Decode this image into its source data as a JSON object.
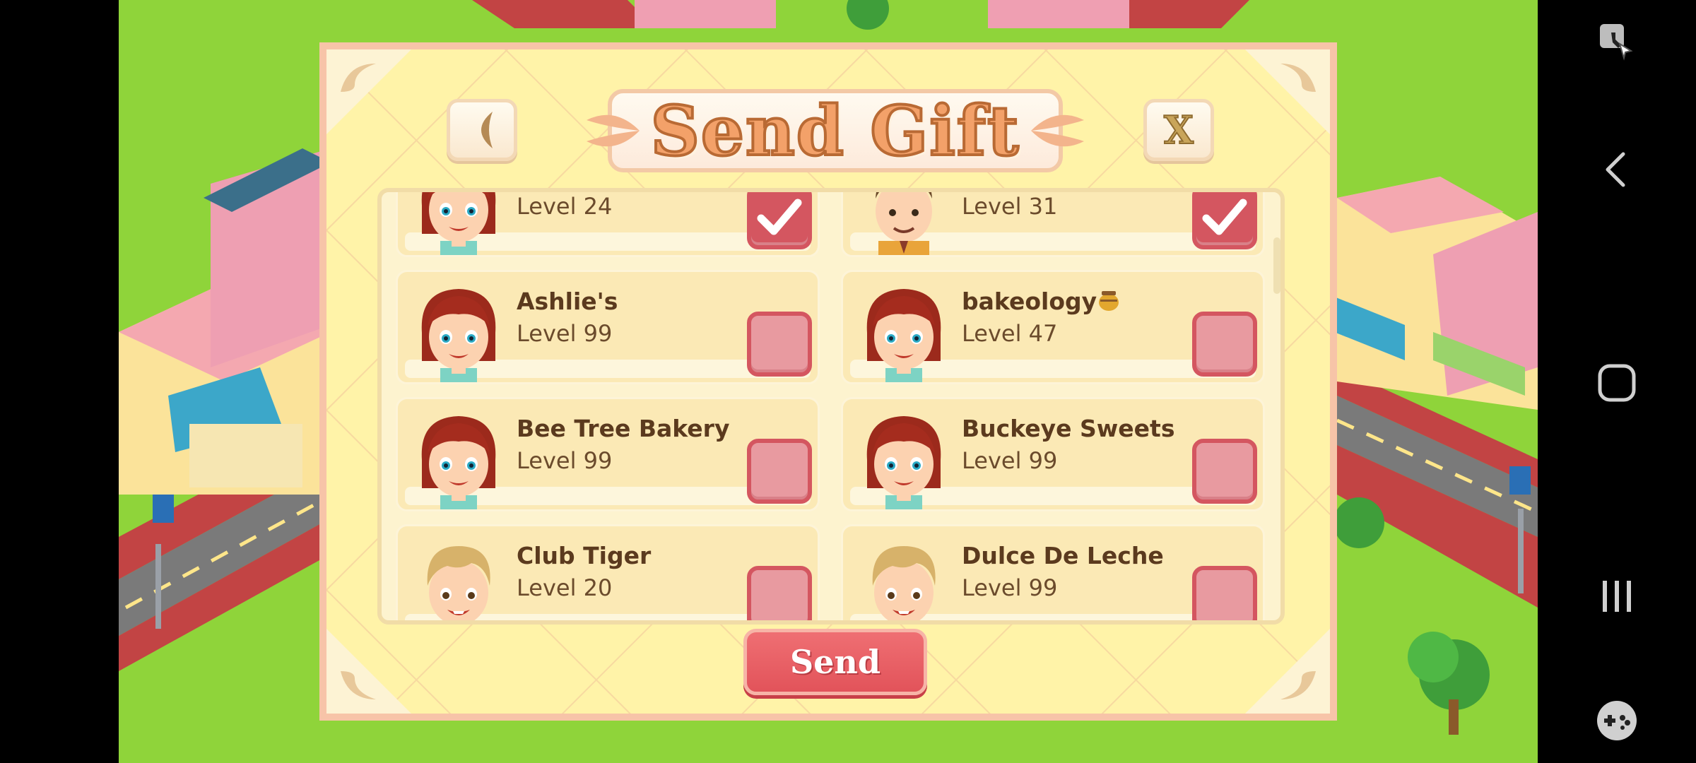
{
  "dialog": {
    "title": "Send Gift",
    "back_icon": "back-arrow-icon",
    "close_label": "X",
    "send_label": "Send"
  },
  "friends": [
    {
      "name": "",
      "level": "Level 24",
      "checked": true,
      "avatar": "girl-avatar"
    },
    {
      "name": "",
      "level": "Level 31",
      "checked": true,
      "avatar": "man-avatar"
    },
    {
      "name": "Ashlie's",
      "level": "Level 99",
      "checked": false,
      "avatar": "girl-avatar"
    },
    {
      "name": "bakeology",
      "name_icon": "honey-pot-icon",
      "level": "Level 47",
      "checked": false,
      "avatar": "girl-avatar"
    },
    {
      "name": "Bee Tree Bakery",
      "level": "Level 99",
      "checked": false,
      "avatar": "girl-avatar"
    },
    {
      "name": "Buckeye Sweets",
      "level": "Level 99",
      "checked": false,
      "avatar": "girl-avatar"
    },
    {
      "name": "Club Tiger",
      "level": "Level 20",
      "checked": false,
      "avatar": "boy-avatar"
    },
    {
      "name": "Dulce De Leche",
      "level": "Level 99",
      "checked": false,
      "avatar": "boy-avatar"
    }
  ],
  "navbar": {
    "icons": [
      "screen-pin-icon",
      "back-icon",
      "home-icon",
      "recents-icon",
      "game-tools-icon"
    ]
  },
  "colors": {
    "grass": "#8fd43a",
    "dialog_bg": "#fff3a8",
    "checkbox_red": "#d45660",
    "send_red": "#e2535a"
  }
}
